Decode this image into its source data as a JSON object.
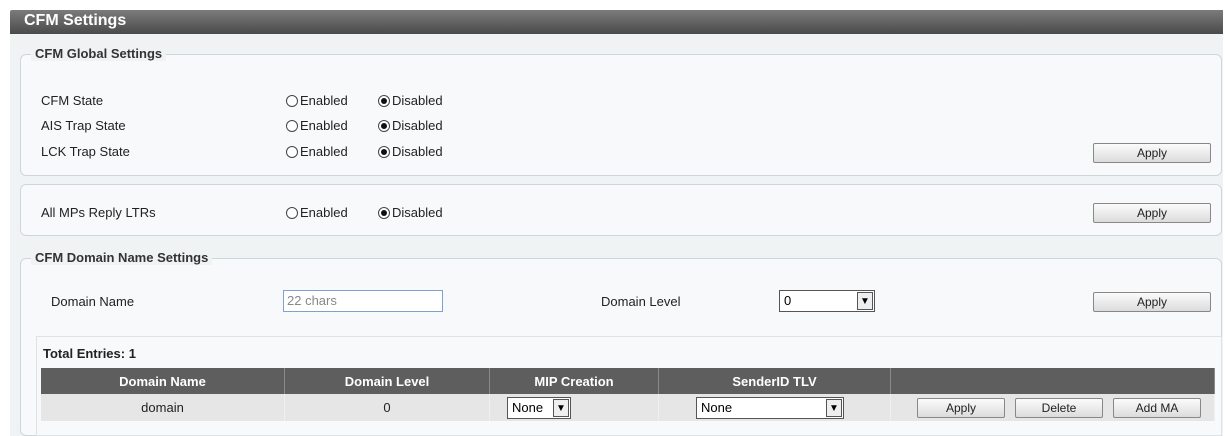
{
  "page": {
    "title": "CFM Settings"
  },
  "global": {
    "legend": "CFM Global Settings",
    "rows": [
      {
        "label": "CFM State",
        "enabled": "Enabled",
        "disabled": "Disabled",
        "selected": "Disabled"
      },
      {
        "label": "AIS Trap State",
        "enabled": "Enabled",
        "disabled": "Disabled",
        "selected": "Disabled"
      },
      {
        "label": "LCK Trap State",
        "enabled": "Enabled",
        "disabled": "Disabled",
        "selected": "Disabled"
      }
    ],
    "apply_label": "Apply"
  },
  "ltr": {
    "label": "All MPs Reply LTRs",
    "enabled": "Enabled",
    "disabled": "Disabled",
    "selected": "Disabled",
    "apply_label": "Apply"
  },
  "domain": {
    "legend": "CFM Domain Name Settings",
    "name_label": "Domain Name",
    "name_placeholder": "22 chars",
    "level_label": "Domain Level",
    "level_value": "0",
    "apply_label": "Apply"
  },
  "table": {
    "total": "Total Entries: 1",
    "headers": [
      "Domain Name",
      "Domain Level",
      "MIP Creation",
      "SenderID TLV",
      ""
    ],
    "rows": [
      {
        "domain_name": "domain",
        "domain_level": "0",
        "mip_creation": "None",
        "senderid_tlv": "None"
      }
    ],
    "actions": {
      "apply": "Apply",
      "delete": "Delete",
      "add_ma": "Add MA"
    }
  }
}
